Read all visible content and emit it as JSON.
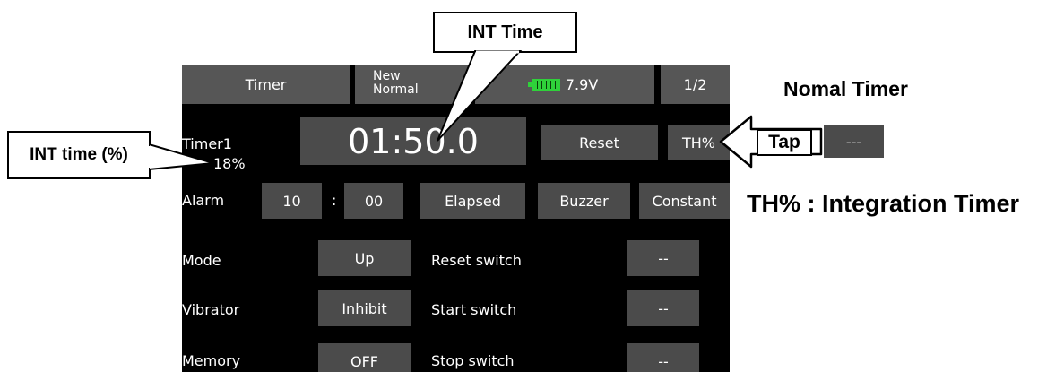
{
  "callouts": {
    "int_time": "INT Time",
    "int_time_pct": "INT time (%)",
    "normal_timer": "Nomal Timer",
    "tap": "Tap",
    "normal_timer_btn": "---",
    "integration_timer": "TH% : Integration Timer"
  },
  "header": {
    "title": "Timer",
    "model_line1": "New",
    "model_line2": "Normal",
    "battery_voltage": "7.9V",
    "page": "1/2"
  },
  "timer": {
    "label": "Timer1",
    "display": "01:50.0",
    "int_percent": "18%",
    "reset_label": "Reset",
    "th_label": "TH%"
  },
  "alarm": {
    "label": "Alarm",
    "minutes": "10",
    "separator": ":",
    "seconds": "00",
    "type": "Elapsed",
    "sound": "Buzzer",
    "mode": "Constant"
  },
  "rows": [
    {
      "label": "Mode",
      "value": "Up",
      "switch_label": "Reset switch",
      "switch_value": "--"
    },
    {
      "label": "Vibrator",
      "value": "Inhibit",
      "switch_label": "Start switch",
      "switch_value": "--"
    },
    {
      "label": "Memory",
      "value": "OFF",
      "switch_label": "Stop switch",
      "switch_value": "--"
    }
  ],
  "colors": {
    "screen_bg": "#000000",
    "header_bg": "#565656",
    "button_bg": "#4b4b4b",
    "battery_green": "#2fd13a"
  }
}
